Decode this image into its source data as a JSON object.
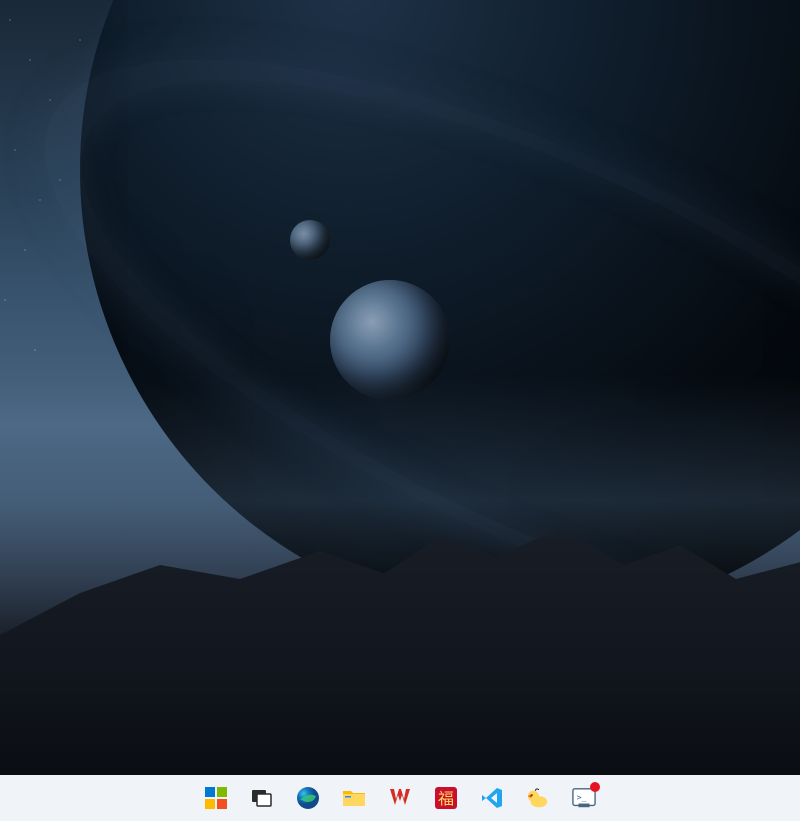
{
  "desktop": {
    "wallpaper_description": "Space scene with ringed planet, moons, and mountain silhouette"
  },
  "taskbar": {
    "items": [
      {
        "name": "start-button",
        "icon": "windows-icon",
        "label": "Start"
      },
      {
        "name": "task-view-button",
        "icon": "task-view-icon",
        "label": "Task View"
      },
      {
        "name": "edge-button",
        "icon": "edge-icon",
        "label": "Microsoft Edge"
      },
      {
        "name": "file-explorer-button",
        "icon": "folder-icon",
        "label": "File Explorer"
      },
      {
        "name": "wps-button",
        "icon": "wps-icon",
        "label": "WPS Office"
      },
      {
        "name": "fu-app-button",
        "icon": "fu-icon",
        "label": "福"
      },
      {
        "name": "vscode-button",
        "icon": "vscode-icon",
        "label": "Visual Studio Code"
      },
      {
        "name": "duck-app-button",
        "icon": "duck-icon",
        "label": "Duck App"
      },
      {
        "name": "terminal-button",
        "icon": "terminal-icon",
        "label": "Terminal",
        "has_badge": true
      }
    ]
  },
  "colors": {
    "taskbar_bg": "#f0f3f8",
    "badge": "#e81123",
    "win_blue": "#0078d4",
    "win_green": "#7fba00",
    "win_yellow": "#ffb900",
    "win_red": "#f25022",
    "wps_red": "#d32d26",
    "fu_red": "#c8102e",
    "vscode_blue": "#22a5f1",
    "folder_yellow": "#ffb900"
  }
}
